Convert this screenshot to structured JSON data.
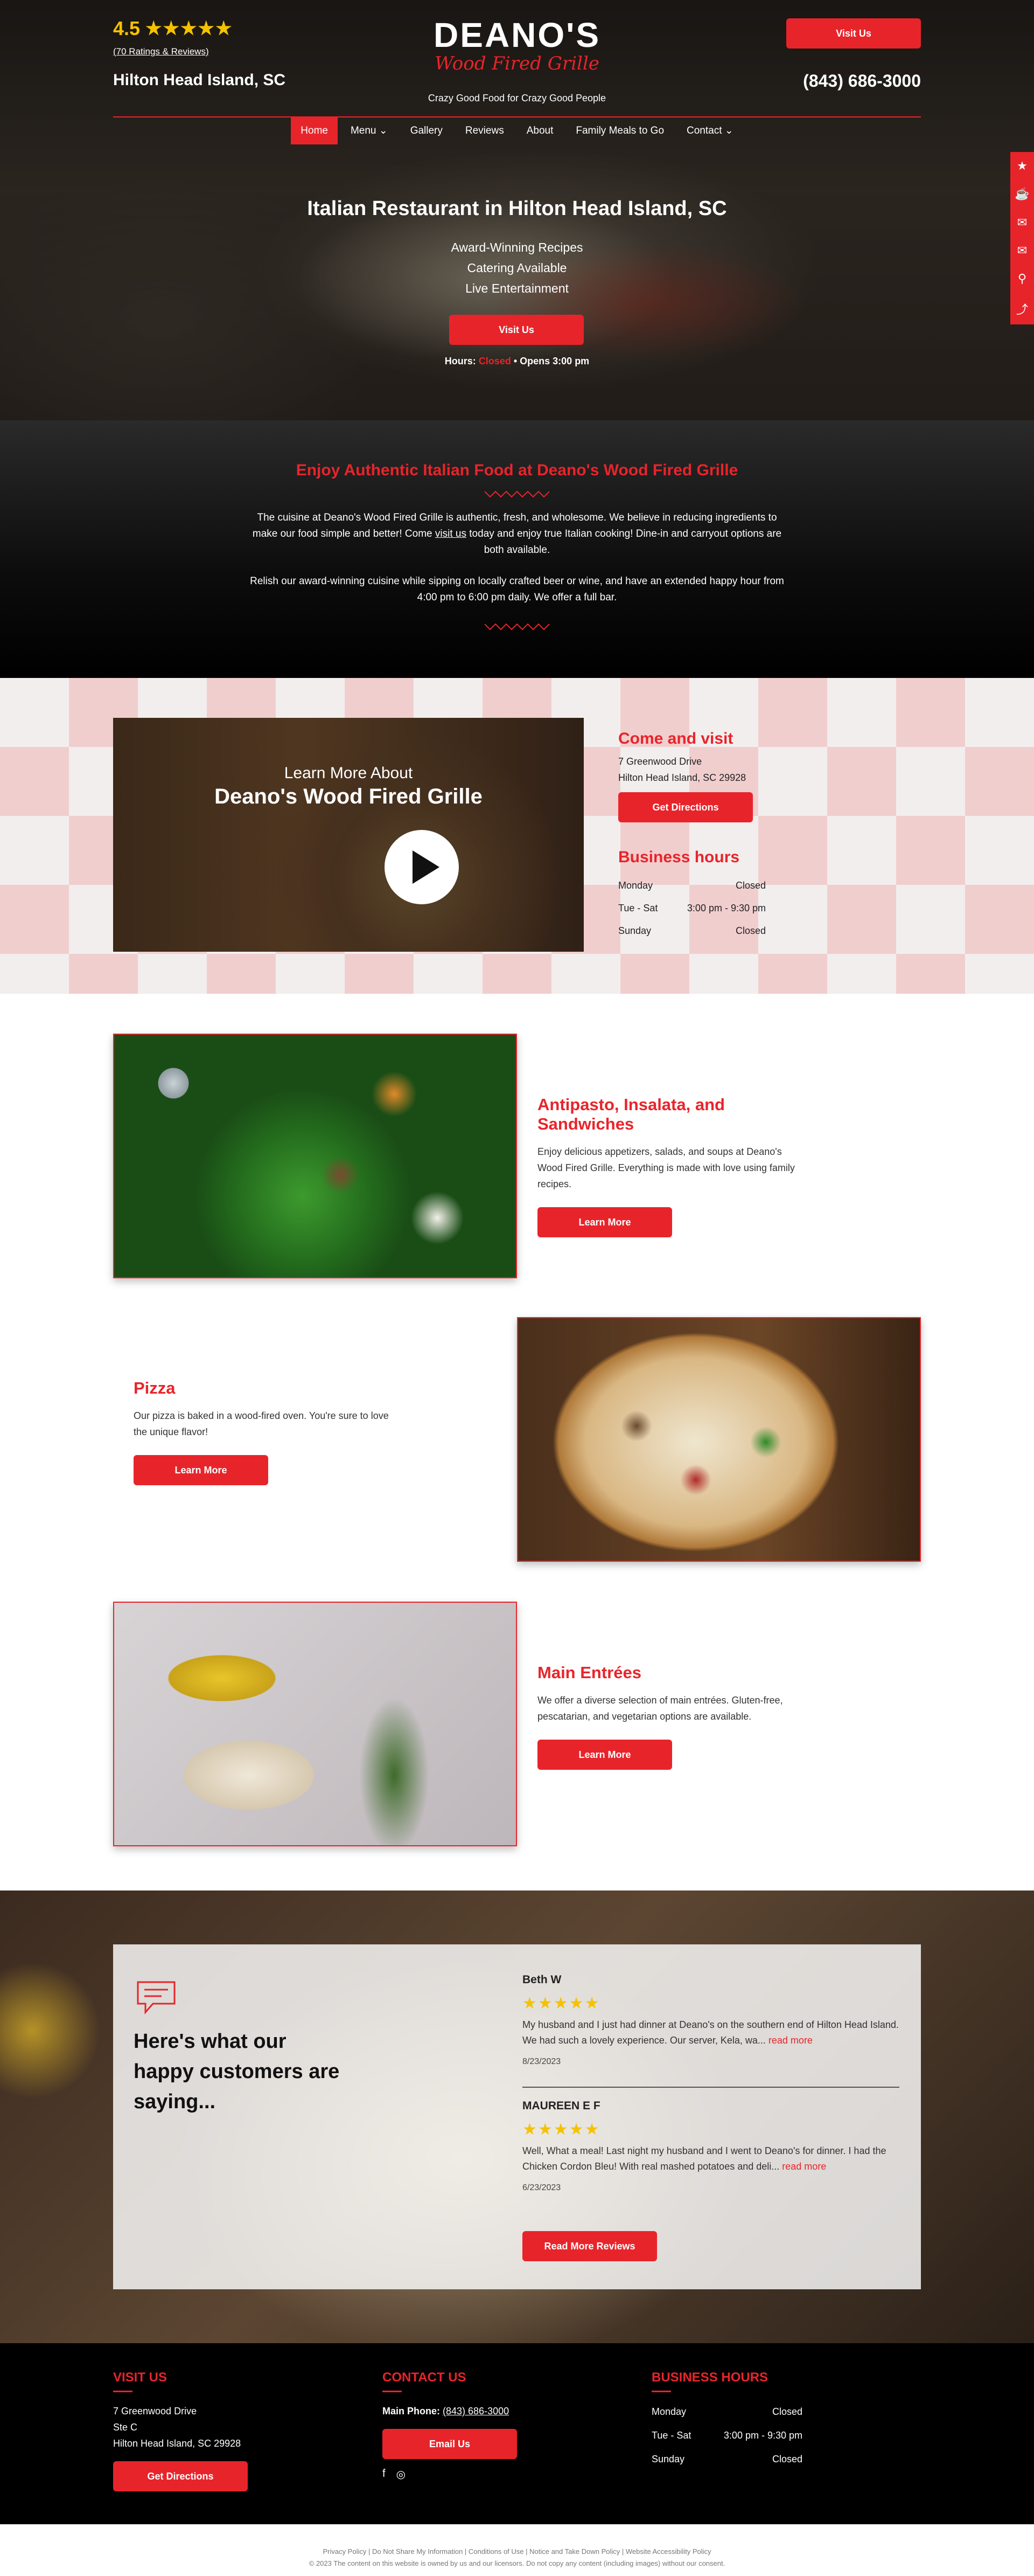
{
  "header": {
    "rating_value": "4.5",
    "rating_stars": "★★★★★",
    "rating_link": "(70 Ratings & Reviews)",
    "location": "Hilton Head Island, SC",
    "logo_main": "DEANO'S",
    "logo_sub": "Wood Fired Grille",
    "tagline": "Crazy Good Food for Crazy Good People",
    "visit_button": "Visit Us",
    "phone": "(843) 686-3000"
  },
  "nav": {
    "items": [
      "Home",
      "Menu ⌄",
      "Gallery",
      "Reviews",
      "About",
      "Family Meals to Go",
      "Contact ⌄"
    ]
  },
  "hero": {
    "heading": "Italian Restaurant in Hilton Head Island, SC",
    "features": [
      "Award-Winning Recipes",
      "Catering Available",
      "Live Entertainment"
    ],
    "button": "Visit Us",
    "hours_label": "Hours:",
    "hours_status": "Closed",
    "hours_next": "• Opens 3:00 pm"
  },
  "intro": {
    "heading": "Enjoy Authentic Italian Food at Deano's Wood Fired Grille",
    "p1_before": "The cuisine at Deano's Wood Fired Grille is authentic, fresh, and wholesome. We believe in reducing ingredients to make our food simple and better! Come ",
    "p1_link": "visit us",
    "p1_after": " today and enjoy true Italian cooking! Dine-in and carryout options are both available.",
    "p2": "Relish our award-winning cuisine while sipping on locally crafted beer or wine, and have an extended happy hour from 4:00 pm to 6:00 pm daily. We offer a full bar."
  },
  "visit": {
    "video_line1": "Learn More About",
    "video_line2": "Deano's Wood Fired Grille",
    "come_heading": "Come and visit",
    "address_line1": "7 Greenwood Drive",
    "address_line2": "Hilton Head Island, SC 29928",
    "directions_button": "Get Directions",
    "hours_heading": "Business hours",
    "hours": [
      {
        "day": "Monday",
        "time": "Closed"
      },
      {
        "day": "Tue - Sat",
        "time": "3:00 pm - 9:30 pm"
      },
      {
        "day": "Sunday",
        "time": "Closed"
      }
    ]
  },
  "menu": {
    "items": [
      {
        "title": "Antipasto, Insalata, and Sandwiches",
        "text": "Enjoy delicious appetizers, salads, and soups at Deano's Wood Fired Grille. Everything is made with love using family recipes.",
        "button": "Learn More"
      },
      {
        "title": "Pizza",
        "text": "Our pizza is baked in a wood-fired oven. You're sure to love the unique flavor!",
        "button": "Learn More"
      },
      {
        "title": "Main Entrées",
        "text": "We offer a diverse selection of main entrées. Gluten-free, pescatarian, and vegetarian options are available.",
        "button": "Learn More"
      }
    ]
  },
  "reviews": {
    "heading": "Here's what our happy customers are saying...",
    "items": [
      {
        "name": "Beth W",
        "stars": "★★★★★",
        "text": "My husband and I just had dinner at Deano's on the southern end of Hilton Head Island. We had such a lovely experience. Our server, Kela, wa...",
        "more": "read more",
        "date": "8/23/2023"
      },
      {
        "name": "MAUREEN E F",
        "stars": "★★★★★",
        "text": "Well, What a meal! Last night my husband and I went to Deano's for dinner. I had the Chicken Cordon Bleu! With real mashed potatoes and deli...",
        "more": "read more",
        "date": "6/23/2023"
      }
    ],
    "button": "Read More Reviews"
  },
  "footer": {
    "visit_heading": "VISIT US",
    "visit_lines": [
      "7 Greenwood Drive",
      "Ste C",
      "Hilton Head Island, SC 29928"
    ],
    "directions_button": "Get Directions",
    "contact_heading": "CONTACT US",
    "phone_label": "Main Phone:",
    "phone": "(843) 686-3000",
    "email_button": "Email Us",
    "hours_heading": "BUSINESS HOURS",
    "hours": [
      {
        "day": "Monday",
        "time": "Closed"
      },
      {
        "day": "Tue - Sat",
        "time": "3:00 pm - 9:30 pm"
      },
      {
        "day": "Sunday",
        "time": "Closed"
      }
    ]
  },
  "legal": {
    "links": "Privacy Policy | Do Not Share My Information | Conditions of Use | Notice and Take Down Policy | Website Accessibility Policy",
    "copyright": "© 2023 The content on this website is owned by us and our licensors. Do not copy any content (including images) without our consent."
  },
  "colors": {
    "accent": "#e8242b",
    "star": "#f5c200",
    "dark": "#000000"
  }
}
